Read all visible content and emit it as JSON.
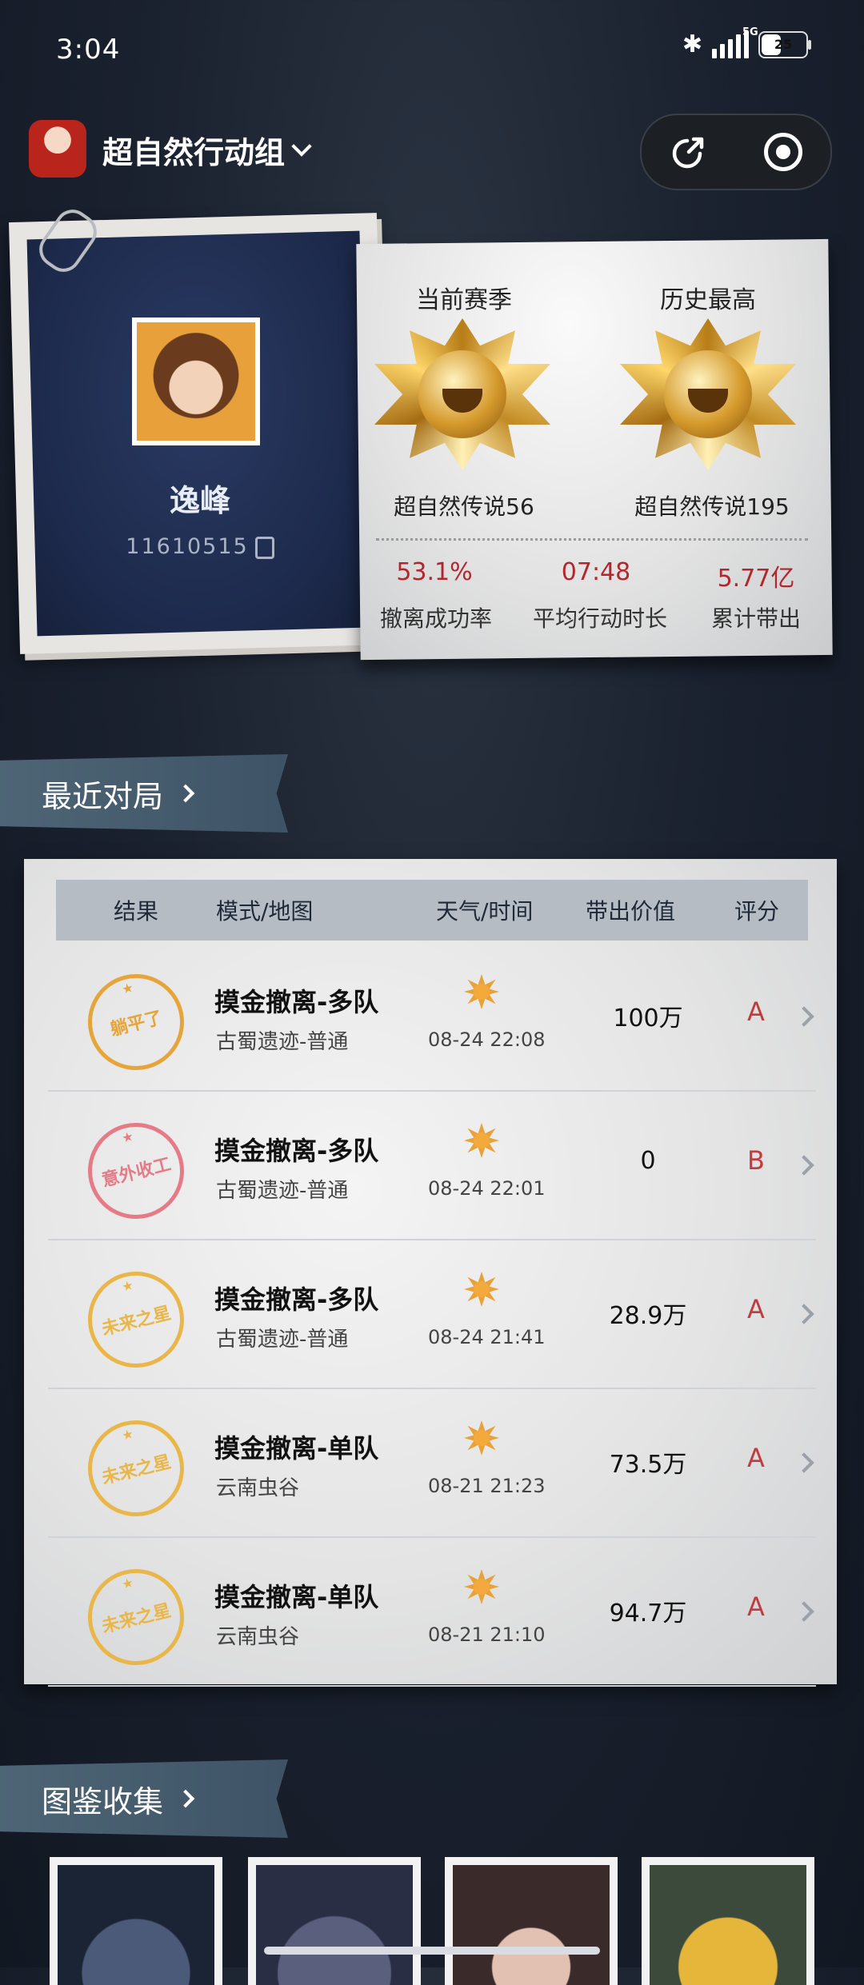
{
  "status_bar": {
    "time": "3:04",
    "network": "5G",
    "battery": "25"
  },
  "header": {
    "title": "超自然行动组",
    "share_icon": "share-icon",
    "close_icon": "record-icon"
  },
  "profile": {
    "name": "逸峰",
    "id": "11610515",
    "current_season_label": "当前赛季",
    "best_label": "历史最高",
    "current_rank": "超自然传说56",
    "best_rank": "超自然传说195",
    "stats": [
      {
        "value": "53.1%",
        "label": "撤离成功率"
      },
      {
        "value": "07:48",
        "label": "平均行动时长"
      },
      {
        "value": "5.77亿",
        "label": "累计带出"
      }
    ]
  },
  "recent": {
    "title": "最近对局",
    "columns": [
      "结果",
      "模式/地图",
      "天气/时间",
      "带出价值",
      "评分"
    ],
    "rows": [
      {
        "stamp": "躺平了",
        "stamp_color": "#e5a53a",
        "mode": "摸金撤离-多队",
        "map": "古蜀遗迹-普通",
        "datetime": "08-24 22:08",
        "value": "100万",
        "grade": "A"
      },
      {
        "stamp": "意外收工",
        "stamp_color": "#e47b86",
        "mode": "摸金撤离-多队",
        "map": "古蜀遗迹-普通",
        "datetime": "08-24 22:01",
        "value": "0",
        "grade": "B"
      },
      {
        "stamp": "未来之星",
        "stamp_color": "#e9b64a",
        "mode": "摸金撤离-多队",
        "map": "古蜀遗迹-普通",
        "datetime": "08-24 21:41",
        "value": "28.9万",
        "grade": "A"
      },
      {
        "stamp": "未来之星",
        "stamp_color": "#e9b64a",
        "mode": "摸金撤离-单队",
        "map": "云南虫谷",
        "datetime": "08-21 21:23",
        "value": "73.5万",
        "grade": "A"
      },
      {
        "stamp": "未来之星",
        "stamp_color": "#e9b64a",
        "mode": "摸金撤离-单队",
        "map": "云南虫谷",
        "datetime": "08-21 21:10",
        "value": "94.7万",
        "grade": "A"
      }
    ]
  },
  "gallery": {
    "title": "图鉴收集"
  },
  "colors": {
    "accent_red": "#b4262e",
    "banner": "#4e6576"
  }
}
